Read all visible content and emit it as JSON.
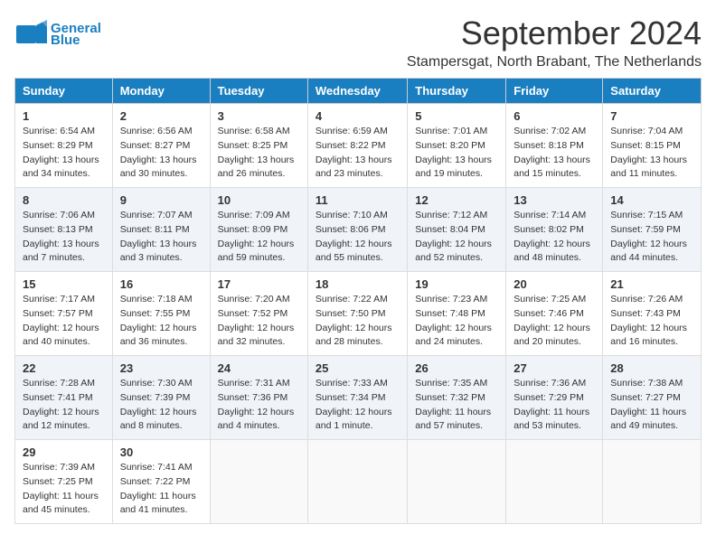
{
  "header": {
    "logo_line1": "General",
    "logo_line2": "Blue",
    "month_title": "September 2024",
    "subtitle": "Stampersgat, North Brabant, The Netherlands"
  },
  "columns": [
    "Sunday",
    "Monday",
    "Tuesday",
    "Wednesday",
    "Thursday",
    "Friday",
    "Saturday"
  ],
  "weeks": [
    [
      {
        "day": "1",
        "sunrise": "Sunrise: 6:54 AM",
        "sunset": "Sunset: 8:29 PM",
        "daylight": "Daylight: 13 hours and 34 minutes."
      },
      {
        "day": "2",
        "sunrise": "Sunrise: 6:56 AM",
        "sunset": "Sunset: 8:27 PM",
        "daylight": "Daylight: 13 hours and 30 minutes."
      },
      {
        "day": "3",
        "sunrise": "Sunrise: 6:58 AM",
        "sunset": "Sunset: 8:25 PM",
        "daylight": "Daylight: 13 hours and 26 minutes."
      },
      {
        "day": "4",
        "sunrise": "Sunrise: 6:59 AM",
        "sunset": "Sunset: 8:22 PM",
        "daylight": "Daylight: 13 hours and 23 minutes."
      },
      {
        "day": "5",
        "sunrise": "Sunrise: 7:01 AM",
        "sunset": "Sunset: 8:20 PM",
        "daylight": "Daylight: 13 hours and 19 minutes."
      },
      {
        "day": "6",
        "sunrise": "Sunrise: 7:02 AM",
        "sunset": "Sunset: 8:18 PM",
        "daylight": "Daylight: 13 hours and 15 minutes."
      },
      {
        "day": "7",
        "sunrise": "Sunrise: 7:04 AM",
        "sunset": "Sunset: 8:15 PM",
        "daylight": "Daylight: 13 hours and 11 minutes."
      }
    ],
    [
      {
        "day": "8",
        "sunrise": "Sunrise: 7:06 AM",
        "sunset": "Sunset: 8:13 PM",
        "daylight": "Daylight: 13 hours and 7 minutes."
      },
      {
        "day": "9",
        "sunrise": "Sunrise: 7:07 AM",
        "sunset": "Sunset: 8:11 PM",
        "daylight": "Daylight: 13 hours and 3 minutes."
      },
      {
        "day": "10",
        "sunrise": "Sunrise: 7:09 AM",
        "sunset": "Sunset: 8:09 PM",
        "daylight": "Daylight: 12 hours and 59 minutes."
      },
      {
        "day": "11",
        "sunrise": "Sunrise: 7:10 AM",
        "sunset": "Sunset: 8:06 PM",
        "daylight": "Daylight: 12 hours and 55 minutes."
      },
      {
        "day": "12",
        "sunrise": "Sunrise: 7:12 AM",
        "sunset": "Sunset: 8:04 PM",
        "daylight": "Daylight: 12 hours and 52 minutes."
      },
      {
        "day": "13",
        "sunrise": "Sunrise: 7:14 AM",
        "sunset": "Sunset: 8:02 PM",
        "daylight": "Daylight: 12 hours and 48 minutes."
      },
      {
        "day": "14",
        "sunrise": "Sunrise: 7:15 AM",
        "sunset": "Sunset: 7:59 PM",
        "daylight": "Daylight: 12 hours and 44 minutes."
      }
    ],
    [
      {
        "day": "15",
        "sunrise": "Sunrise: 7:17 AM",
        "sunset": "Sunset: 7:57 PM",
        "daylight": "Daylight: 12 hours and 40 minutes."
      },
      {
        "day": "16",
        "sunrise": "Sunrise: 7:18 AM",
        "sunset": "Sunset: 7:55 PM",
        "daylight": "Daylight: 12 hours and 36 minutes."
      },
      {
        "day": "17",
        "sunrise": "Sunrise: 7:20 AM",
        "sunset": "Sunset: 7:52 PM",
        "daylight": "Daylight: 12 hours and 32 minutes."
      },
      {
        "day": "18",
        "sunrise": "Sunrise: 7:22 AM",
        "sunset": "Sunset: 7:50 PM",
        "daylight": "Daylight: 12 hours and 28 minutes."
      },
      {
        "day": "19",
        "sunrise": "Sunrise: 7:23 AM",
        "sunset": "Sunset: 7:48 PM",
        "daylight": "Daylight: 12 hours and 24 minutes."
      },
      {
        "day": "20",
        "sunrise": "Sunrise: 7:25 AM",
        "sunset": "Sunset: 7:46 PM",
        "daylight": "Daylight: 12 hours and 20 minutes."
      },
      {
        "day": "21",
        "sunrise": "Sunrise: 7:26 AM",
        "sunset": "Sunset: 7:43 PM",
        "daylight": "Daylight: 12 hours and 16 minutes."
      }
    ],
    [
      {
        "day": "22",
        "sunrise": "Sunrise: 7:28 AM",
        "sunset": "Sunset: 7:41 PM",
        "daylight": "Daylight: 12 hours and 12 minutes."
      },
      {
        "day": "23",
        "sunrise": "Sunrise: 7:30 AM",
        "sunset": "Sunset: 7:39 PM",
        "daylight": "Daylight: 12 hours and 8 minutes."
      },
      {
        "day": "24",
        "sunrise": "Sunrise: 7:31 AM",
        "sunset": "Sunset: 7:36 PM",
        "daylight": "Daylight: 12 hours and 4 minutes."
      },
      {
        "day": "25",
        "sunrise": "Sunrise: 7:33 AM",
        "sunset": "Sunset: 7:34 PM",
        "daylight": "Daylight: 12 hours and 1 minute."
      },
      {
        "day": "26",
        "sunrise": "Sunrise: 7:35 AM",
        "sunset": "Sunset: 7:32 PM",
        "daylight": "Daylight: 11 hours and 57 minutes."
      },
      {
        "day": "27",
        "sunrise": "Sunrise: 7:36 AM",
        "sunset": "Sunset: 7:29 PM",
        "daylight": "Daylight: 11 hours and 53 minutes."
      },
      {
        "day": "28",
        "sunrise": "Sunrise: 7:38 AM",
        "sunset": "Sunset: 7:27 PM",
        "daylight": "Daylight: 11 hours and 49 minutes."
      }
    ],
    [
      {
        "day": "29",
        "sunrise": "Sunrise: 7:39 AM",
        "sunset": "Sunset: 7:25 PM",
        "daylight": "Daylight: 11 hours and 45 minutes."
      },
      {
        "day": "30",
        "sunrise": "Sunrise: 7:41 AM",
        "sunset": "Sunset: 7:22 PM",
        "daylight": "Daylight: 11 hours and 41 minutes."
      },
      null,
      null,
      null,
      null,
      null
    ]
  ]
}
